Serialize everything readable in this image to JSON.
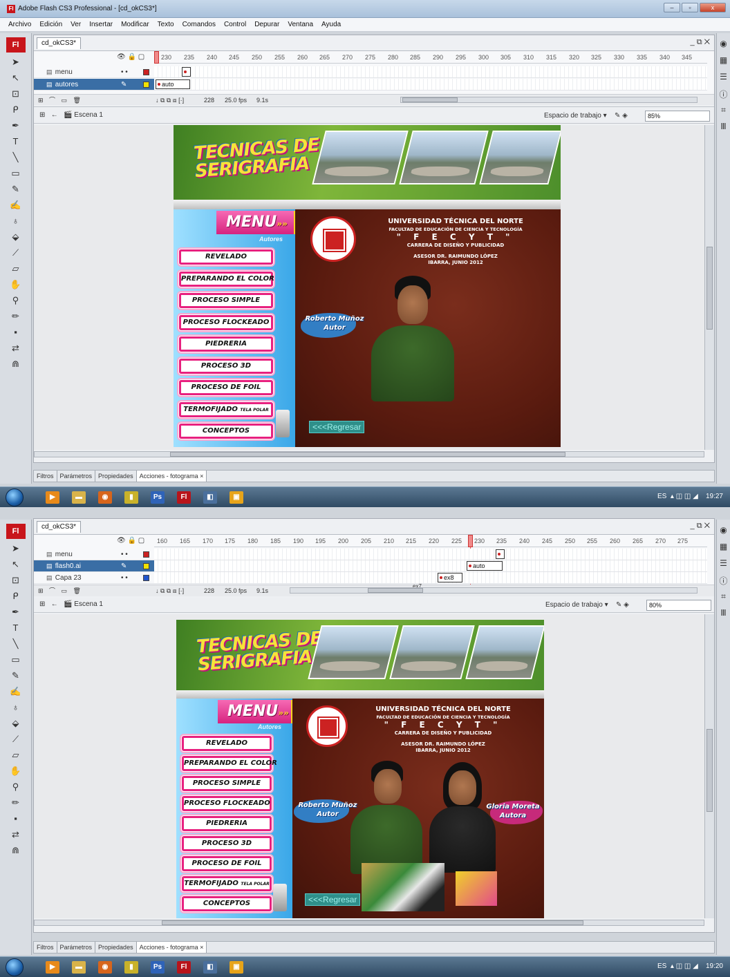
{
  "shots": [
    {
      "window_title": "Adobe Flash CS3 Professional - [cd_okCS3*]",
      "app_icon": "Fl",
      "menu": [
        "Archivo",
        "Edición",
        "Ver",
        "Insertar",
        "Modificar",
        "Texto",
        "Comandos",
        "Control",
        "Depurar",
        "Ventana",
        "Ayuda"
      ],
      "doc_tab": "cd_okCS3*",
      "ruler": [
        "230",
        "235",
        "240",
        "245",
        "250",
        "255",
        "260",
        "265",
        "270",
        "275",
        "280",
        "285",
        "290",
        "295",
        "300",
        "305",
        "310",
        "315",
        "320",
        "325",
        "330",
        "335",
        "340",
        "345"
      ],
      "layers": [
        {
          "name": "menu",
          "selected": false,
          "color": "#cc2222"
        },
        {
          "name": "autores",
          "selected": true,
          "color": "#f2e200"
        }
      ],
      "frame_label": "auto",
      "status": {
        "frame": "228",
        "fps": "25.0 fps",
        "time": "9.1s"
      },
      "scene": "Escena 1",
      "workspace": "Espacio de trabajo",
      "zoom": "85%",
      "panel_tabs": [
        "Filtros",
        "Parámetros",
        "Propiedades",
        "Acciones - fotograma ×"
      ],
      "tray": {
        "lang": "ES",
        "time": "19:27"
      }
    },
    {
      "doc_tab": "cd_okCS3*",
      "ruler": [
        "160",
        "165",
        "170",
        "175",
        "180",
        "185",
        "190",
        "195",
        "200",
        "205",
        "210",
        "215",
        "220",
        "225",
        "230",
        "235",
        "240",
        "245",
        "250",
        "255",
        "260",
        "265",
        "270",
        "275"
      ],
      "layers": [
        {
          "name": "menu",
          "selected": false,
          "color": "#cc2222"
        },
        {
          "name": "flash0.ai",
          "selected": true,
          "color": "#f2e200"
        },
        {
          "name": "Capa 23",
          "selected": false,
          "color": "#2255cc"
        }
      ],
      "frame_labels": [
        "auto",
        "ex8",
        "ex7"
      ],
      "status": {
        "frame": "228",
        "fps": "25.0 fps",
        "time": "9.1s"
      },
      "scene": "Escena 1",
      "workspace": "Espacio de trabajo",
      "zoom": "80%",
      "panel_tabs": [
        "Filtros",
        "Parámetros",
        "Propiedades",
        "Acciones - fotograma ×"
      ],
      "tray": {
        "lang": "ES",
        "time": "19:20"
      }
    }
  ],
  "artwork": {
    "title_line1": "TECNICAS DE",
    "title_line2": "SERIGRAFIA",
    "menu_title": "MENU",
    "menu_arrows": "»»",
    "menu_sub": "Autores",
    "buttons": [
      "REVELADO",
      "PREPARANDO EL COLOR",
      "PROCESO SIMPLE",
      "PROCESO FLOCKEADO",
      "PIEDRERIA",
      "PROCESO 3D",
      "PROCESO DE FOIL",
      "TERMOFIJADO",
      "CONCEPTOS"
    ],
    "termofijado_small": "TELA POLAR",
    "uni_name": "UNIVERSIDAD TÉCNICA DEL NORTE",
    "faculty": "FACULTAD DE EDUCACIÓN DE CIENCIA Y TECNOLOGÍA",
    "fecyt": "\" F E C Y T \"",
    "career": "CARRERA DE DISEÑO Y PUBLICIDAD",
    "advisor": "ASESOR DR. RAIMUNDO LÓPEZ",
    "place_date": "IBARRA, JUNIO 2012",
    "author1_name": "Roberto Muñoz",
    "author1_role": "Autor",
    "author2_name": "Gloria Moreta",
    "author2_role": "Autora",
    "back": "<<<Regresar"
  }
}
